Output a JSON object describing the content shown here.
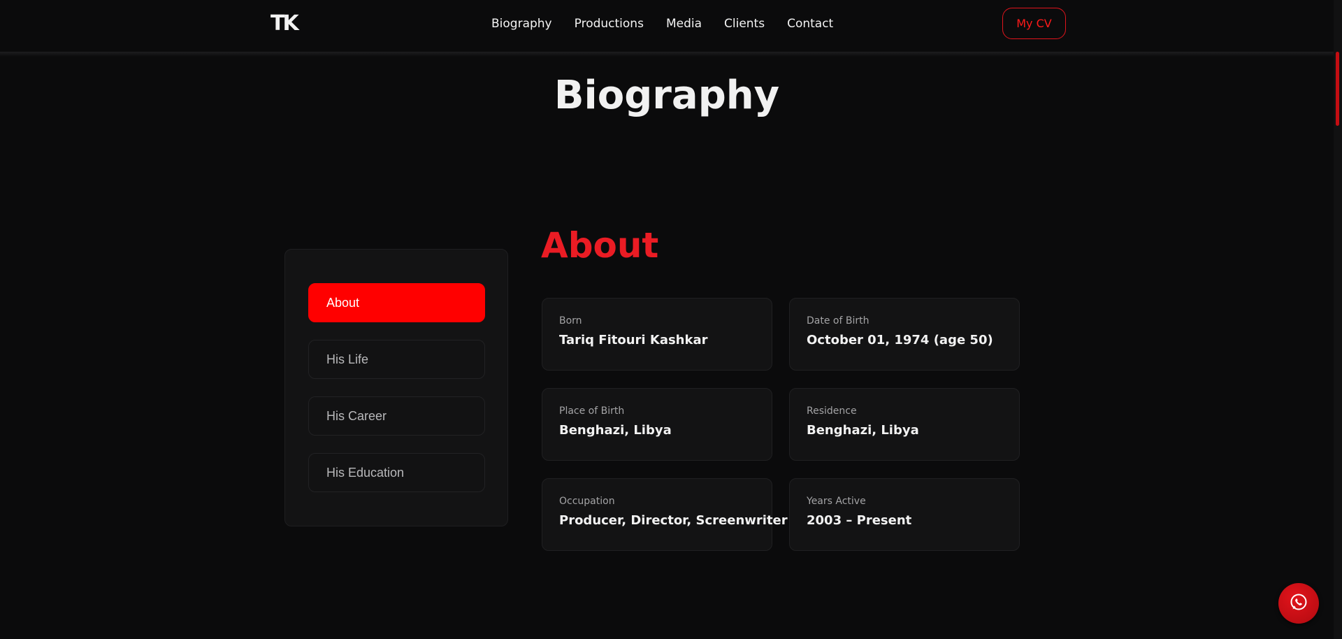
{
  "header": {
    "logo": "TK",
    "nav": [
      "Biography",
      "Productions",
      "Media",
      "Clients",
      "Contact"
    ],
    "cv_button": "My CV"
  },
  "page_title": "Biography",
  "section_title": "About",
  "sidebar": {
    "items": [
      {
        "label": "About",
        "active": true
      },
      {
        "label": "His Life",
        "active": false
      },
      {
        "label": "His Career",
        "active": false
      },
      {
        "label": "His Education",
        "active": false
      }
    ]
  },
  "info_cards": [
    {
      "label": "Born",
      "value": "Tariq Fitouri Kashkar"
    },
    {
      "label": "Date of Birth",
      "value": "October 01, 1974 (age 50)"
    },
    {
      "label": "Place of Birth",
      "value": "Benghazi, Libya"
    },
    {
      "label": "Residence",
      "value": "Benghazi, Libya"
    },
    {
      "label": "Occupation",
      "value": "Producer, Director, Screenwriter"
    },
    {
      "label": "Years Active",
      "value": "2003 – Present"
    }
  ],
  "colors": {
    "accent": "#ff0000",
    "title_red": "#ea1c24",
    "background": "#0b0b0c",
    "card": "#131314"
  },
  "icons": {
    "chat": "whatsapp-icon"
  }
}
